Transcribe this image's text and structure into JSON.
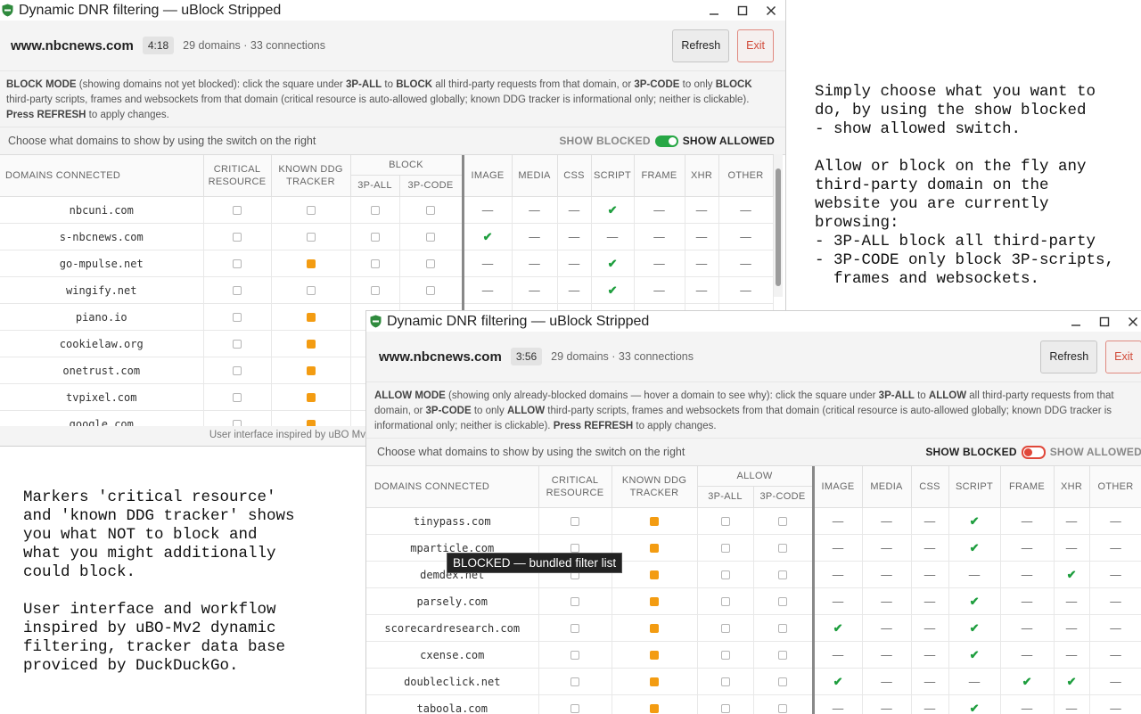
{
  "window1": {
    "title": "Dynamic DNR filtering — uBlock Stripped",
    "site": "www.nbcnews.com",
    "timer": "4:18",
    "summary": "29 domains · 33 connections",
    "refresh": "Refresh",
    "exit": "Exit",
    "explain": {
      "mode": "BLOCK MODE",
      "t1": " (showing domains not yet blocked): click the square under ",
      "k1": "3P-ALL",
      "t2": " to ",
      "k2": "BLOCK",
      "t3": " all third-party requests from that domain, or ",
      "k3": "3P-CODE",
      "t4": " to only ",
      "k4": "BLOCK",
      "t5": " third-party scripts, frames and websockets from that domain (critical resource is auto-allowed globally; known DDG tracker is informational only; neither is clickable). ",
      "k5": "Press REFRESH",
      "t6": " to apply changes."
    },
    "switch_hint": "Choose what domains to show by using the switch on the right",
    "show_blocked": "SHOW BLOCKED",
    "show_allowed": "SHOW ALLOWED",
    "headers": {
      "domains": "DOMAINS CONNECTED",
      "critical_1": "CRITICAL",
      "critical_2": "RESOURCE",
      "ddg_1": "KNOWN DDG",
      "ddg_2": "TRACKER",
      "group": "BLOCK",
      "all": "3P-ALL",
      "code": "3P-CODE",
      "image": "IMAGE",
      "media": "MEDIA",
      "css": "CSS",
      "script": "SCRIPT",
      "frame": "FRAME",
      "xhr": "XHR",
      "other": "OTHER"
    },
    "rows": [
      {
        "domain": "nbcuni.com",
        "ddg": false,
        "types": [
          "—",
          "—",
          "—",
          "✔",
          "—",
          "—",
          "—"
        ]
      },
      {
        "domain": "s-nbcnews.com",
        "ddg": false,
        "types": [
          "✔",
          "—",
          "—",
          "—",
          "—",
          "—",
          "—"
        ]
      },
      {
        "domain": "go-mpulse.net",
        "ddg": true,
        "types": [
          "—",
          "—",
          "—",
          "✔",
          "—",
          "—",
          "—"
        ]
      },
      {
        "domain": "wingify.net",
        "ddg": false,
        "types": [
          "—",
          "—",
          "—",
          "✔",
          "—",
          "—",
          "—"
        ]
      },
      {
        "domain": "piano.io",
        "ddg": true,
        "types": [
          "",
          "",
          "",
          "",
          "",
          "",
          ""
        ]
      },
      {
        "domain": "cookielaw.org",
        "ddg": true,
        "types": [
          "",
          "",
          "",
          "",
          "",
          "",
          ""
        ]
      },
      {
        "domain": "onetrust.com",
        "ddg": true,
        "types": [
          "",
          "",
          "",
          "",
          "",
          "",
          ""
        ]
      },
      {
        "domain": "tvpixel.com",
        "ddg": true,
        "types": [
          "",
          "",
          "",
          "",
          "",
          "",
          ""
        ]
      },
      {
        "domain": "google.com",
        "ddg": true,
        "types": [
          "",
          "",
          "",
          "",
          "",
          "",
          ""
        ]
      }
    ],
    "footer": "User interface inspired by uBO Mv"
  },
  "window2": {
    "title": "Dynamic DNR filtering — uBlock Stripped",
    "site": "www.nbcnews.com",
    "timer": "3:56",
    "summary": "29 domains · 33 connections",
    "refresh": "Refresh",
    "exit": "Exit",
    "explain": {
      "mode": "ALLOW MODE",
      "t1": " (showing only already-blocked domains — hover a domain to see why): click the square under ",
      "k1": "3P-ALL",
      "t2": " to ",
      "k2": "ALLOW",
      "t3": " all third-party requests from that domain, or ",
      "k3": "3P-CODE",
      "t4": " to only ",
      "k4": "ALLOW",
      "t5": " third-party scripts, frames and websockets from that domain (critical resource is auto-allowed globally; known DDG tracker is informational only; neither is clickable). ",
      "k5": "Press REFRESH",
      "t6": " to apply changes."
    },
    "switch_hint": "Choose what domains to show by using the switch on the right",
    "show_blocked": "SHOW BLOCKED",
    "show_allowed": "SHOW ALLOWED",
    "headers": {
      "domains": "DOMAINS CONNECTED",
      "critical_1": "CRITICAL",
      "critical_2": "RESOURCE",
      "ddg_1": "KNOWN DDG",
      "ddg_2": "TRACKER",
      "group": "ALLOW",
      "all": "3P-ALL",
      "code": "3P-CODE",
      "image": "IMAGE",
      "media": "MEDIA",
      "css": "CSS",
      "script": "SCRIPT",
      "frame": "FRAME",
      "xhr": "XHR",
      "other": "OTHER"
    },
    "rows": [
      {
        "domain": "tinypass.com",
        "ddg": true,
        "types": [
          "—",
          "—",
          "—",
          "✔",
          "—",
          "—",
          "—"
        ]
      },
      {
        "domain": "mparticle.com",
        "ddg": true,
        "types": [
          "—",
          "—",
          "—",
          "✔",
          "—",
          "—",
          "—"
        ]
      },
      {
        "domain": "demdex.net",
        "ddg": true,
        "types": [
          "—",
          "—",
          "—",
          "—",
          "—",
          "✔",
          "—"
        ]
      },
      {
        "domain": "parsely.com",
        "ddg": true,
        "types": [
          "—",
          "—",
          "—",
          "✔",
          "—",
          "—",
          "—"
        ]
      },
      {
        "domain": "scorecardresearch.com",
        "ddg": true,
        "types": [
          "✔",
          "—",
          "—",
          "✔",
          "—",
          "—",
          "—"
        ]
      },
      {
        "domain": "cxense.com",
        "ddg": true,
        "types": [
          "—",
          "—",
          "—",
          "✔",
          "—",
          "—",
          "—"
        ]
      },
      {
        "domain": "doubleclick.net",
        "ddg": true,
        "types": [
          "✔",
          "—",
          "—",
          "—",
          "✔",
          "✔",
          "—"
        ]
      },
      {
        "domain": "taboola.com",
        "ddg": true,
        "types": [
          "—",
          "—",
          "—",
          "✔",
          "—",
          "—",
          "—"
        ]
      }
    ],
    "tooltip": "BLOCKED — bundled filter list"
  },
  "notes": {
    "right": "Simply choose what you want to\ndo, by using the show blocked\n- show allowed switch.\n\nAllow or block on the fly any\nthird-party domain on the\nwebsite you are currently\nbrowsing:\n- 3P-ALL block all third-party\n- 3P-CODE only block 3P-scripts,\n  frames and websockets.",
    "left": "Markers 'critical resource'\nand 'known DDG tracker' shows\nyou what NOT to block and\nwhat you might additionally\ncould block.\n\nUser interface and workflow\ninspired by uBO-Mv2 dynamic\nfiltering, tracker data base\nproviced by DuckDuckGo."
  },
  "colors": {
    "tracker_marker": "#f39c12",
    "check": "#1e9e3e",
    "toggle_on": "#27a745",
    "toggle_off": "#e0483a",
    "exit_text": "#d14b3a"
  }
}
